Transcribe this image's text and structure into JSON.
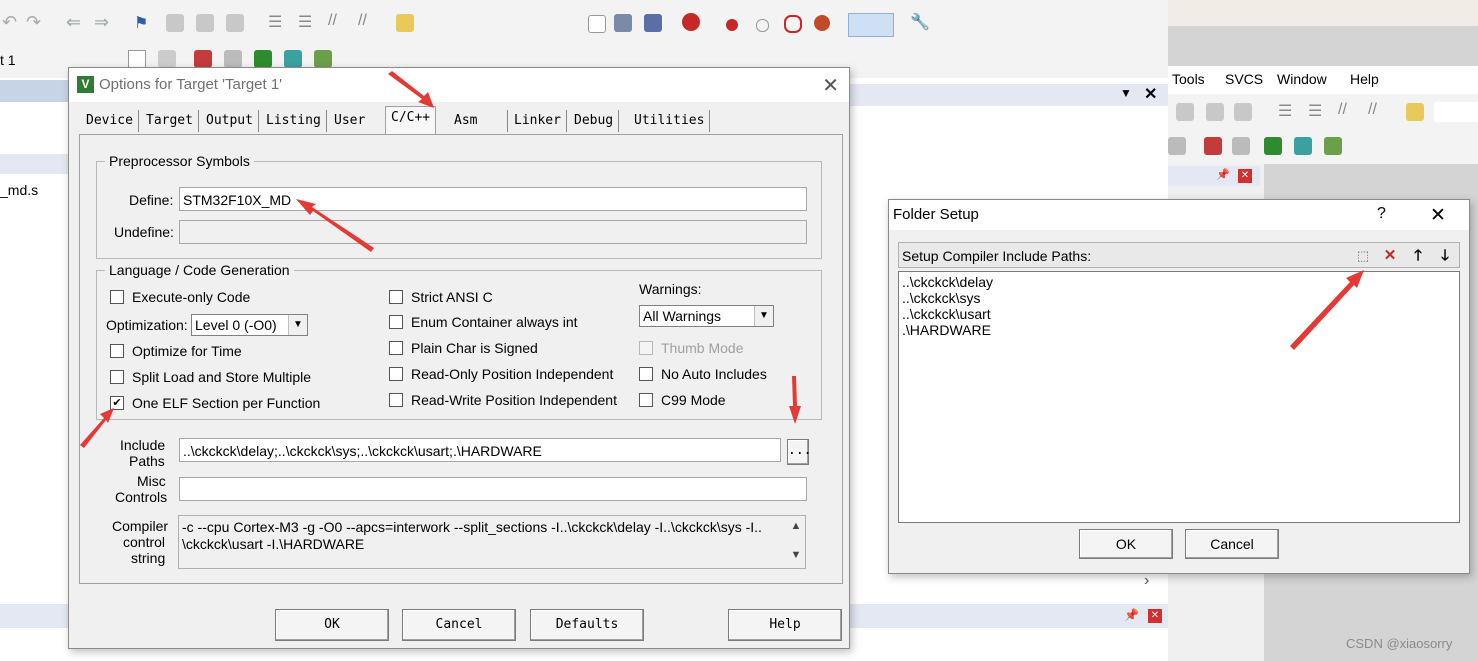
{
  "background": {
    "target_label": "t 1",
    "file_label": "_md.s",
    "menu": [
      "Tools",
      "SVCS",
      "Window",
      "Help"
    ]
  },
  "options_dialog": {
    "title": "Options for Target 'Target 1'",
    "tabs": [
      "Device",
      "Target",
      "Output",
      "Listing",
      "User",
      "C/C++",
      "Asm",
      "Linker",
      "Debug",
      "Utilities"
    ],
    "active_tab": "C/C++",
    "preprocessor": {
      "legend": "Preprocessor Symbols",
      "define_label": "Define:",
      "define_value": "STM32F10X_MD",
      "undefine_label": "Undefine:",
      "undefine_value": ""
    },
    "language": {
      "legend": "Language / Code Generation",
      "execute_only": "Execute-only Code",
      "optimization_label": "Optimization:",
      "optimization_value": "Level 0 (-O0)",
      "optimize_for_time": "Optimize for Time",
      "split_load": "Split Load and Store Multiple",
      "one_elf": "One ELF Section per Function",
      "strict_ansi": "Strict ANSI C",
      "enum_container": "Enum Container always int",
      "plain_char": "Plain Char is Signed",
      "ro_position": "Read-Only Position Independent",
      "rw_position": "Read-Write Position Independent",
      "warnings_label": "Warnings:",
      "warnings_value": "All Warnings",
      "thumb_mode": "Thumb Mode",
      "no_auto_includes": "No Auto Includes",
      "c99_mode": "C99 Mode"
    },
    "include_paths_label_1": "Include",
    "include_paths_label_2": "Paths",
    "include_paths_value": "..\\ckckck\\delay;..\\ckckck\\sys;..\\ckckck\\usart;.\\HARDWARE",
    "browse_label": "...",
    "misc_label_1": "Misc",
    "misc_label_2": "Controls",
    "misc_value": "",
    "compiler_label_1": "Compiler",
    "compiler_label_2": "control",
    "compiler_label_3": "string",
    "compiler_line_1": "-c --cpu Cortex-M3 -g -O0 --apcs=interwork --split_sections -I..\\ckckck\\delay -I..\\ckckck\\sys -I..",
    "compiler_line_2": "\\ckckck\\usart -I.\\HARDWARE",
    "buttons": {
      "ok": "OK",
      "cancel": "Cancel",
      "defaults": "Defaults",
      "help": "Help"
    }
  },
  "folder_setup": {
    "title": "Folder Setup",
    "help": "?",
    "close": "✕",
    "list_header": "Setup Compiler Include Paths:",
    "paths": [
      "..\\ckckck\\delay",
      "..\\ckckck\\sys",
      "..\\ckckck\\usart",
      ".\\HARDWARE"
    ],
    "ok": "OK",
    "cancel": "Cancel"
  },
  "watermark": "CSDN @xiaosorry"
}
